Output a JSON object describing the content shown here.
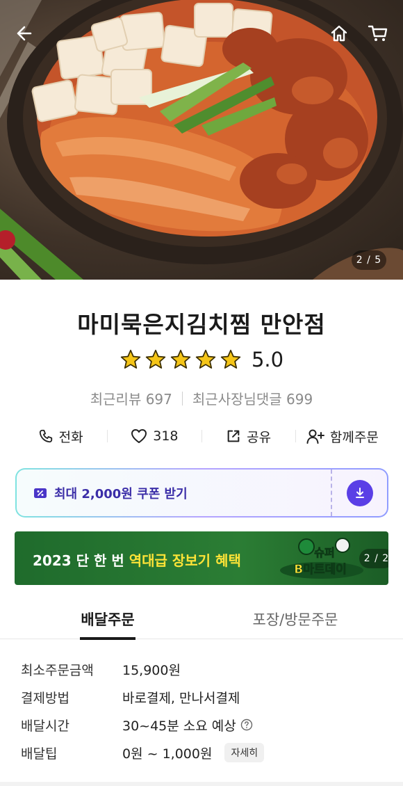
{
  "hero": {
    "image_counter": "2 / 5",
    "icons": [
      "back-arrow-icon",
      "home-icon",
      "cart-icon"
    ]
  },
  "store": {
    "name": "마미묵은지김치찜 만안점",
    "rating": "5.0",
    "stars": 5,
    "recent_reviews": "최근리뷰 697",
    "owner_replies": "최근사장님댓글 699"
  },
  "actions": {
    "call": "전화",
    "likes": "318",
    "share": "공유",
    "group_order": "함께주문"
  },
  "coupon": {
    "label": "최대 2,000원 쿠폰 받기"
  },
  "banner": {
    "text_before": "2023 단 한 번 ",
    "text_highlight": "역대급 장보기 혜택",
    "logo_line1": "슈퍼",
    "logo_line2": "B마트데이",
    "page": "2 / 2"
  },
  "tabs": {
    "delivery": "배달주문",
    "pickup": "포장/방문주문",
    "active": "delivery"
  },
  "info": {
    "min_order_label": "최소주문금액",
    "min_order_value": "15,900원",
    "payment_label": "결제방법",
    "payment_value": "바로결제, 만나서결제",
    "delivery_time_label": "배달시간",
    "delivery_time_value": "30~45분 소요 예상",
    "tip_label": "배달팁",
    "tip_value": "0원 ~ 1,000원",
    "tip_detail": "자세히"
  },
  "colors": {
    "accent": "#5a3fe6",
    "star": "#f5c518",
    "banner_green": "#2b7d34",
    "banner_highlight": "#ffe437"
  }
}
